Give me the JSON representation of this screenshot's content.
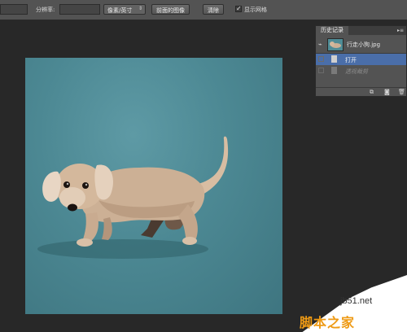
{
  "options_bar": {
    "resolution_label": "分辨率:",
    "unit_select": "像素/英寸",
    "front_image_button": "前面的图像",
    "clear_button": "清除",
    "grid_checkbox_label": "显示网格",
    "grid_checked": true
  },
  "history_panel": {
    "tab_title": "历史记录",
    "snapshot_label": "行走小狗.jpg",
    "steps": [
      {
        "label": "打开",
        "active": true
      },
      {
        "label": "透视裁剪",
        "active": false
      }
    ],
    "footer_icons": [
      "new-document-from-state-icon",
      "camera-icon",
      "trash-icon"
    ]
  },
  "document": {
    "image_subject": "dachshund-puppy",
    "background_color": "#4e8a95"
  },
  "watermark": {
    "url": "jb51.net",
    "logo_text": "脚本之家"
  }
}
